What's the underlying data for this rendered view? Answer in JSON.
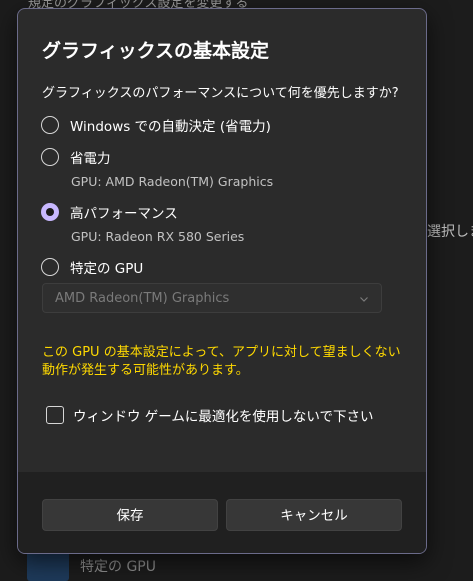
{
  "background": {
    "top_text": "規定のグラフィックス設定を変更する",
    "right_text": "選択しま",
    "bottom_text": "特定の GPU"
  },
  "dialog": {
    "title": "グラフィックスの基本設定",
    "question": "グラフィックスのパフォーマンスについて何を優先しますか?",
    "options": [
      {
        "label": "Windows での自動決定 (省電力)",
        "sub": "",
        "checked": false
      },
      {
        "label": "省電力",
        "sub": "GPU: AMD Radeon(TM) Graphics",
        "checked": false
      },
      {
        "label": "高パフォーマンス",
        "sub": "GPU: Radeon RX 580 Series",
        "checked": true
      },
      {
        "label": "特定の GPU",
        "sub": "",
        "checked": false
      }
    ],
    "gpu_select": {
      "value": "AMD Radeon(TM) Graphics",
      "disabled": true
    },
    "warning": "この GPU の基本設定によって、アプリに対して望ましくない動作が発生する可能性があります。",
    "checkbox": {
      "label": "ウィンドウ ゲームに最適化を使用しないで下さい",
      "checked": false
    },
    "buttons": {
      "save": "保存",
      "cancel": "キャンセル"
    }
  },
  "colors": {
    "accent": "#c8b8ff",
    "warning": "#ffd900",
    "dialog_bg": "#2b2b2b",
    "footer_bg": "#202020"
  }
}
